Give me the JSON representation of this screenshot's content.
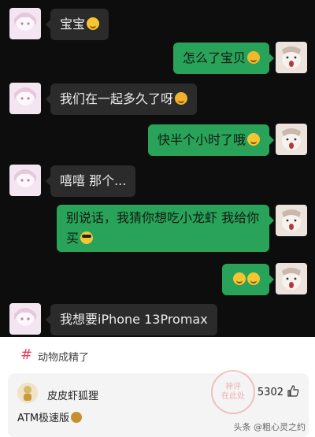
{
  "chat": {
    "messages": [
      {
        "side": "left",
        "text": "宝宝",
        "emoji": "smile"
      },
      {
        "side": "right",
        "text": "怎么了宝贝",
        "emoji": "tease"
      },
      {
        "side": "left",
        "text": "我们在一起多久了呀",
        "emoji": "sweat"
      },
      {
        "side": "right",
        "text": "快半个小时了哦",
        "emoji": "smile"
      },
      {
        "side": "left",
        "text": "嘻嘻 那个...",
        "emoji": ""
      },
      {
        "side": "right",
        "text": "别说话，我猜你想吃小龙虾 我给你买",
        "emoji": "cool"
      },
      {
        "side": "right",
        "text": "",
        "emoji": "double-laugh"
      },
      {
        "side": "left",
        "text": "我想要iPhone 13Promax",
        "emoji": ""
      }
    ],
    "bubble_colors": {
      "incoming": "#2b2b2b",
      "outgoing": "#29a35a",
      "background": "#0d0d0d"
    }
  },
  "post_bar": {
    "hash_symbol": "#",
    "title": "动物成精了"
  },
  "comment": {
    "username": "皮皮虾狐狸",
    "likes": "5302",
    "text": "ATM极速版",
    "like_icon": "thumbs-up-icon"
  },
  "stamp": {
    "text_line1": "神评",
    "text_line2": "在此处"
  },
  "watermark": "头条 @粗心灵之约"
}
